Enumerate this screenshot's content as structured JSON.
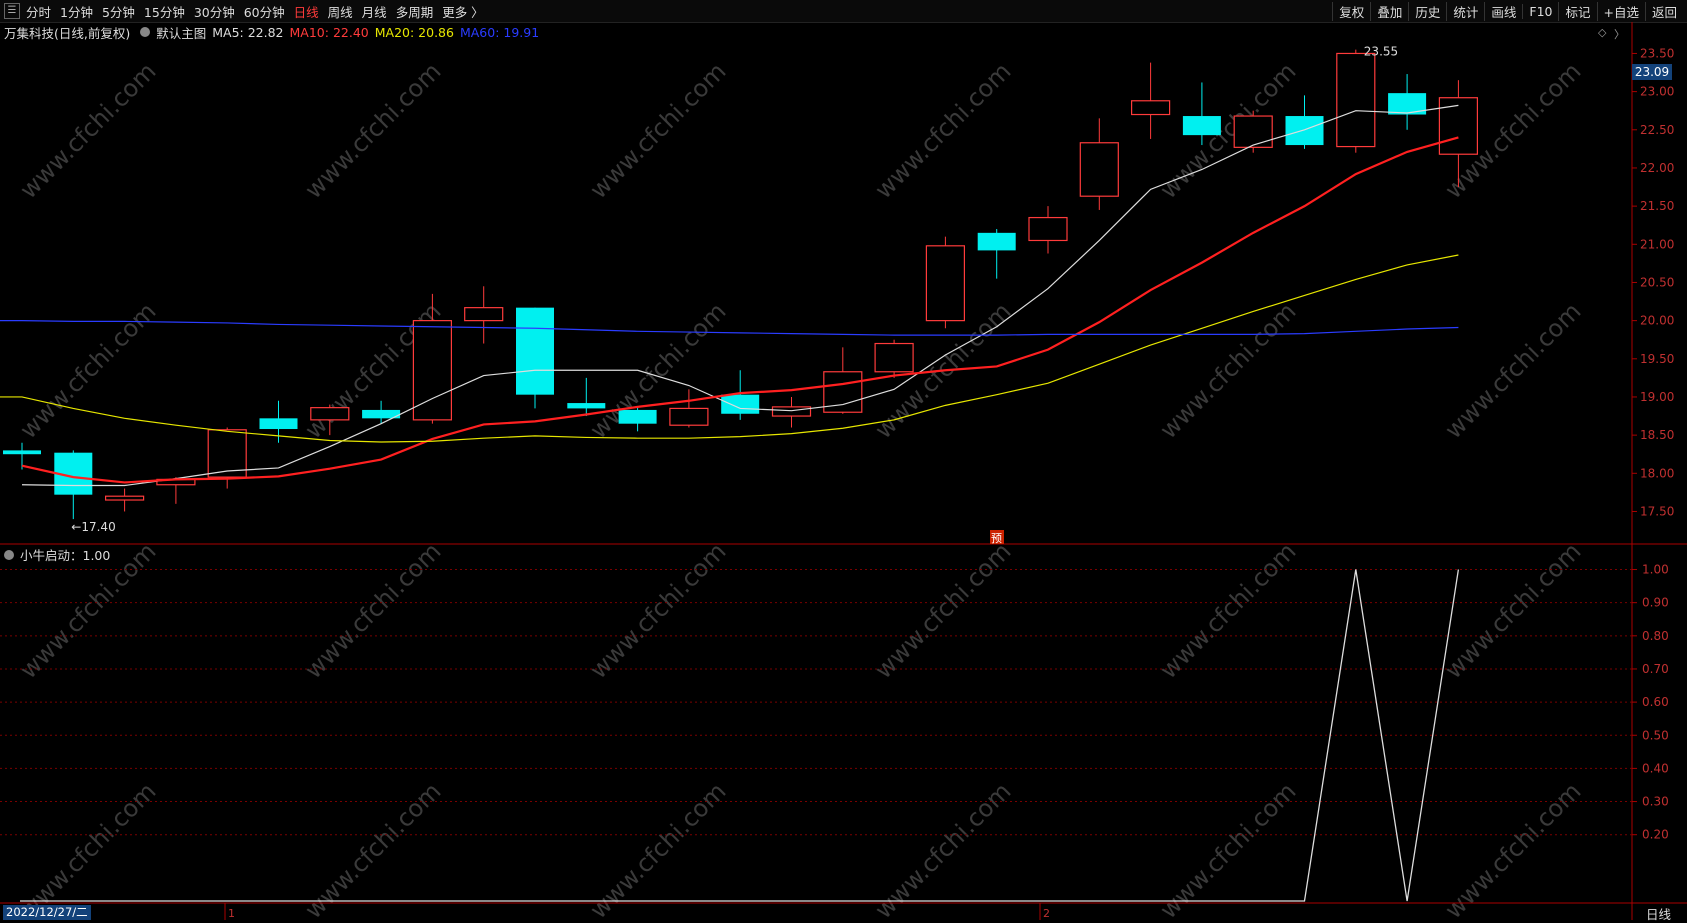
{
  "toolbar": {
    "periods": [
      "分时",
      "1分钟",
      "5分钟",
      "15分钟",
      "30分钟",
      "60分钟",
      "日线",
      "周线",
      "月线",
      "多周期",
      "更多 〉"
    ],
    "active_index": 6,
    "right_buttons": [
      "复权",
      "叠加",
      "历史",
      "统计",
      "画线",
      "F10",
      "标记",
      "+自选",
      "返回"
    ]
  },
  "info": {
    "stock": "万集科技(日线,前复权)",
    "main_chart": "默认主图",
    "ma5": "MA5: 22.82",
    "ma10": "MA10: 22.40",
    "ma20": "MA20: 20.86",
    "ma60": "MA60: 19.91"
  },
  "indicator": {
    "label": "小牛启动：1.00"
  },
  "bottom": {
    "date": "2022/12/27/二",
    "period": "日线",
    "month_marks": [
      "1",
      "2"
    ]
  },
  "markers": {
    "pre_label": "预",
    "low_label": "17.40",
    "high_label": "23.55",
    "last_price": "23.09"
  },
  "colors": {
    "up": "#ff3b3b",
    "down": "#00f0f0",
    "ma5": "#dddddd",
    "ma10": "#ff2020",
    "ma20": "#e6e600",
    "ma60": "#2a3cff",
    "grid": "#7a0000"
  },
  "watermark": "www.cfchi.com",
  "chart_data": [
    {
      "type": "candlestick",
      "title": "",
      "ylim": [
        17.1,
        23.65
      ],
      "y_ticks": [
        17.5,
        18.0,
        18.5,
        19.0,
        19.5,
        20.0,
        20.5,
        21.0,
        21.5,
        22.0,
        22.5,
        23.0,
        23.5
      ],
      "y_tick_labels": [
        "17.50",
        "18.00",
        "18.50",
        "19.00",
        "19.50",
        "20.00",
        "20.50",
        "21.00",
        "21.50",
        "22.00",
        "22.50",
        "23.00",
        "23.50"
      ],
      "candles": [
        {
          "o": 18.3,
          "h": 18.4,
          "l": 18.05,
          "c": 18.25
        },
        {
          "o": 18.27,
          "h": 18.3,
          "l": 17.4,
          "c": 17.72
        },
        {
          "o": 17.65,
          "h": 17.8,
          "l": 17.5,
          "c": 17.7
        },
        {
          "o": 17.85,
          "h": 17.95,
          "l": 17.6,
          "c": 17.92
        },
        {
          "o": 17.95,
          "h": 18.6,
          "l": 17.8,
          "c": 18.57
        },
        {
          "o": 18.72,
          "h": 18.95,
          "l": 18.4,
          "c": 18.58
        },
        {
          "o": 18.7,
          "h": 18.9,
          "l": 18.5,
          "c": 18.86
        },
        {
          "o": 18.83,
          "h": 18.95,
          "l": 18.65,
          "c": 18.72
        },
        {
          "o": 18.7,
          "h": 20.35,
          "l": 18.65,
          "c": 20.0
        },
        {
          "o": 20.0,
          "h": 20.45,
          "l": 19.7,
          "c": 20.17
        },
        {
          "o": 20.17,
          "h": 20.17,
          "l": 18.85,
          "c": 19.03
        },
        {
          "o": 18.92,
          "h": 19.25,
          "l": 18.75,
          "c": 18.85
        },
        {
          "o": 18.83,
          "h": 18.88,
          "l": 18.55,
          "c": 18.65
        },
        {
          "o": 18.63,
          "h": 19.1,
          "l": 18.6,
          "c": 18.85
        },
        {
          "o": 19.03,
          "h": 19.35,
          "l": 18.7,
          "c": 18.78
        },
        {
          "o": 18.75,
          "h": 19.0,
          "l": 18.6,
          "c": 18.87
        },
        {
          "o": 18.8,
          "h": 19.65,
          "l": 18.78,
          "c": 19.33
        },
        {
          "o": 19.33,
          "h": 19.75,
          "l": 19.25,
          "c": 19.7
        },
        {
          "o": 20.0,
          "h": 21.1,
          "l": 19.9,
          "c": 20.98
        },
        {
          "o": 21.15,
          "h": 21.2,
          "l": 20.55,
          "c": 20.92
        },
        {
          "o": 21.05,
          "h": 21.5,
          "l": 20.88,
          "c": 21.35
        },
        {
          "o": 21.63,
          "h": 22.65,
          "l": 21.45,
          "c": 22.33
        },
        {
          "o": 22.7,
          "h": 23.38,
          "l": 22.38,
          "c": 22.88
        },
        {
          "o": 22.68,
          "h": 23.12,
          "l": 22.3,
          "c": 22.43
        },
        {
          "o": 22.27,
          "h": 22.75,
          "l": 22.2,
          "c": 22.68
        },
        {
          "o": 22.68,
          "h": 22.95,
          "l": 22.25,
          "c": 22.3
        },
        {
          "o": 22.28,
          "h": 23.55,
          "l": 22.2,
          "c": 23.5
        },
        {
          "o": 22.98,
          "h": 23.23,
          "l": 22.5,
          "c": 22.7
        },
        {
          "o": 22.18,
          "h": 23.15,
          "l": 21.75,
          "c": 22.92
        }
      ],
      "series": [
        {
          "name": "MA5",
          "values": [
            17.85,
            17.84,
            17.84,
            17.93,
            18.03,
            18.07,
            18.35,
            18.65,
            18.98,
            19.28,
            19.35,
            19.35,
            19.35,
            19.15,
            18.85,
            18.82,
            18.9,
            19.1,
            19.55,
            19.92,
            20.42,
            21.05,
            21.72,
            21.98,
            22.3,
            22.5,
            22.75,
            22.72,
            22.82
          ]
        },
        {
          "name": "MA10",
          "values": [
            18.1,
            17.95,
            17.88,
            17.92,
            17.93,
            17.96,
            18.06,
            18.18,
            18.45,
            18.64,
            18.68,
            18.77,
            18.87,
            18.95,
            19.05,
            19.09,
            19.17,
            19.28,
            19.35,
            19.4,
            19.62,
            19.98,
            20.4,
            20.76,
            21.15,
            21.5,
            21.92,
            22.21,
            22.4
          ]
        },
        {
          "name": "MA20",
          "values": [
            19.0,
            18.85,
            18.72,
            18.63,
            18.55,
            18.49,
            18.43,
            18.41,
            18.42,
            18.46,
            18.49,
            18.47,
            18.46,
            18.46,
            18.48,
            18.52,
            18.59,
            18.7,
            18.89,
            19.03,
            19.18,
            19.43,
            19.68,
            19.9,
            20.12,
            20.33,
            20.54,
            20.73,
            20.86
          ]
        },
        {
          "name": "MA60",
          "values": [
            20.0,
            19.99,
            19.99,
            19.98,
            19.97,
            19.95,
            19.94,
            19.93,
            19.92,
            19.91,
            19.9,
            19.88,
            19.86,
            19.85,
            19.84,
            19.83,
            19.82,
            19.81,
            19.81,
            19.81,
            19.82,
            19.82,
            19.82,
            19.82,
            19.82,
            19.83,
            19.86,
            19.89,
            19.91
          ]
        }
      ]
    },
    {
      "type": "line",
      "title": "",
      "ylim": [
        0,
        1.08
      ],
      "y_ticks": [
        0.2,
        0.3,
        0.4,
        0.5,
        0.6,
        0.7,
        0.8,
        0.9,
        1.0
      ],
      "y_tick_labels": [
        "0.20",
        "0.30",
        "0.40",
        "0.50",
        "0.60",
        "0.70",
        "0.80",
        "0.90",
        "1.00"
      ],
      "series": [
        {
          "name": "小牛启动",
          "values": [
            0,
            0,
            0,
            0,
            0,
            0,
            0,
            0,
            0,
            0,
            0,
            0,
            0,
            0,
            0,
            0,
            0,
            0,
            0,
            0,
            0,
            0,
            0,
            0,
            0,
            0,
            1,
            0,
            1
          ]
        }
      ]
    }
  ]
}
